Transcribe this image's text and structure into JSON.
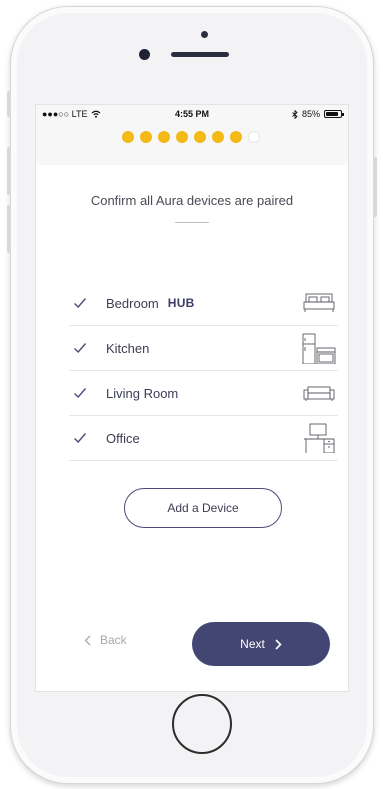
{
  "status_bar": {
    "carrier": "●●●○○ LTE",
    "time": "4:55 PM",
    "battery_text": "85%",
    "battery_level_percent": 85
  },
  "progress": {
    "total_steps": 8,
    "completed_steps": 7,
    "active_color": "#f3b915"
  },
  "screen_title": "Confirm all Aura devices are paired",
  "devices": [
    {
      "name": "Bedroom",
      "badge": "HUB",
      "icon": "bed-icon"
    },
    {
      "name": "Kitchen",
      "badge": "",
      "icon": "kitchen-appliances-icon"
    },
    {
      "name": "Living Room",
      "badge": "",
      "icon": "sofa-icon"
    },
    {
      "name": "Office",
      "badge": "",
      "icon": "desk-icon"
    }
  ],
  "add_device_label": "Add a Device",
  "nav": {
    "back_label": "Back",
    "next_label": "Next"
  },
  "colors": {
    "primary": "#434673",
    "accent": "#f3b915",
    "text": "#3c3d55"
  }
}
